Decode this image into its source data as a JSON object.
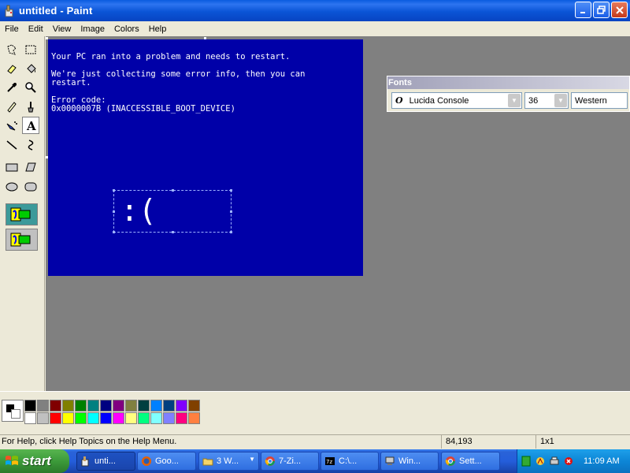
{
  "window": {
    "title": "untitled - Paint"
  },
  "menu": [
    "File",
    "Edit",
    "View",
    "Image",
    "Colors",
    "Help"
  ],
  "canvas": {
    "lines": [
      "Your PC ran into a problem and needs to restart.",
      "We're just collecting some error info, then you can",
      "restart.",
      "Error code:",
      "0x0000007B (INACCESSIBLE_BOOT_DEVICE)"
    ],
    "sad_face": ":(",
    "background": "#0000a8"
  },
  "fonts_toolbar": {
    "title": "Fonts",
    "font_name": "Lucida Console",
    "font_size": "36",
    "script": "Western"
  },
  "palette": {
    "top_row": [
      "#000000",
      "#808080",
      "#800000",
      "#808000",
      "#008000",
      "#008080",
      "#000080",
      "#800080",
      "#808040",
      "#004040",
      "#0080ff",
      "#004080",
      "#8000ff",
      "#804000"
    ],
    "bottom_row": [
      "#ffffff",
      "#c0c0c0",
      "#ff0000",
      "#ffff00",
      "#00ff00",
      "#00ffff",
      "#0000ff",
      "#ff00ff",
      "#ffff80",
      "#00ff80",
      "#80ffff",
      "#8080ff",
      "#ff0080",
      "#ff8040"
    ]
  },
  "status": {
    "help": "For Help, click Help Topics on the Help Menu.",
    "position": "84,193",
    "size": "1x1"
  },
  "taskbar": {
    "start": "start",
    "items": [
      "unti...",
      "Goo...",
      "3 W...",
      "7-Zi...",
      "C:\\...",
      "Win...",
      "Sett..."
    ],
    "clock": "11:09 AM"
  }
}
